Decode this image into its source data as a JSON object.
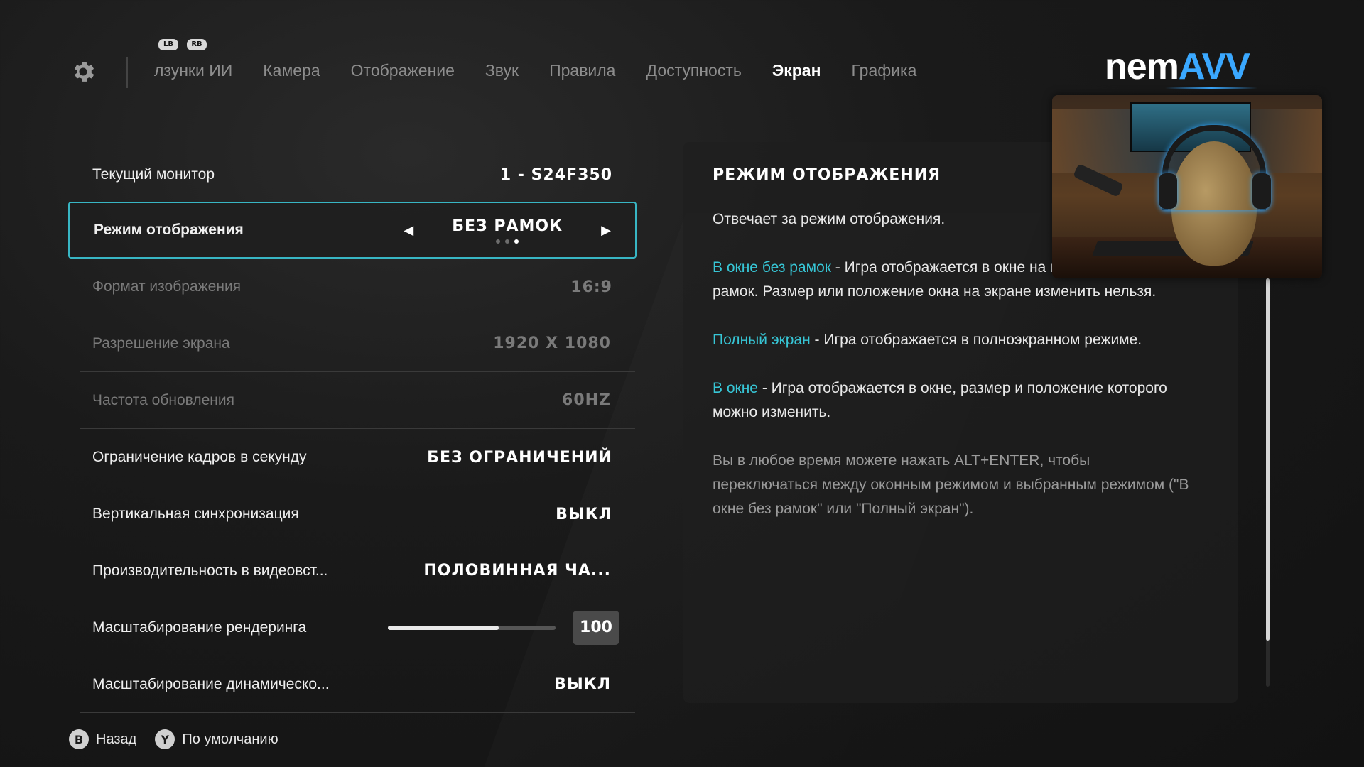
{
  "nav": {
    "bumpers": {
      "left": "LB",
      "right": "RB"
    },
    "tabs": [
      {
        "label": "лзунки ИИ",
        "active": false
      },
      {
        "label": "Камера",
        "active": false
      },
      {
        "label": "Отображение",
        "active": false
      },
      {
        "label": "Звук",
        "active": false
      },
      {
        "label": "Правила",
        "active": false
      },
      {
        "label": "Доступность",
        "active": false
      },
      {
        "label": "Экран",
        "active": true
      },
      {
        "label": "Графика",
        "active": false
      }
    ]
  },
  "logo": {
    "text_main": "nem",
    "text_accent": "AVV",
    "accent_color": "#3aa8ff"
  },
  "settings": [
    {
      "label": "Текущий монитор",
      "value": "1 - S24F350",
      "state": "normal"
    },
    {
      "label": "Режим отображения",
      "value": "БЕЗ РАМОК",
      "state": "selected",
      "option_count": 3,
      "option_index": 3
    },
    {
      "label": "Формат изображения",
      "value": "16:9",
      "state": "disabled"
    },
    {
      "label": "Разрешение экрана",
      "value": "1920 X 1080",
      "state": "disabled"
    },
    {
      "label": "Частота обновления",
      "value": "60HZ",
      "state": "disabled"
    },
    {
      "label": "Ограничение кадров в секунду",
      "value": "БЕЗ ОГРАНИЧЕНИЙ",
      "state": "normal"
    },
    {
      "label": "Вертикальная синхронизация",
      "value": "ВЫКЛ",
      "state": "normal"
    },
    {
      "label": "Производительность в видеовст...",
      "value": "ПОЛОВИННАЯ ЧА...",
      "state": "normal"
    },
    {
      "label": "Масштабирование рендеринга",
      "value": "100",
      "state": "slider",
      "slider_fraction": 0.66
    },
    {
      "label": "Масштабирование динамическо...",
      "value": "ВЫКЛ",
      "state": "normal"
    }
  ],
  "description": {
    "title": "РЕЖИМ ОТОБРАЖЕНИЯ",
    "intro": "Отвечает за режим отображения.",
    "items": [
      {
        "term": "В окне без рамок",
        "text": " - Игра отображается в окне на весь экран без рамок. Размер или положение окна на экране изменить нельзя."
      },
      {
        "term": "Полный экран",
        "text": " - Игра отображается в полноэкранном режиме."
      },
      {
        "term": "В окне",
        "text": " - Игра отображается в окне, размер и положение которого можно изменить."
      }
    ],
    "note": "Вы в любое время можете нажать ALT+ENTER, чтобы переключаться между оконным режимом и выбранным режимом (\"В окне без рамок\" или \"Полный экран\").",
    "highlight_color": "#37c6d6"
  },
  "footer": [
    {
      "button": "B",
      "label": "Назад"
    },
    {
      "button": "Y",
      "label": "По умолчанию"
    }
  ]
}
